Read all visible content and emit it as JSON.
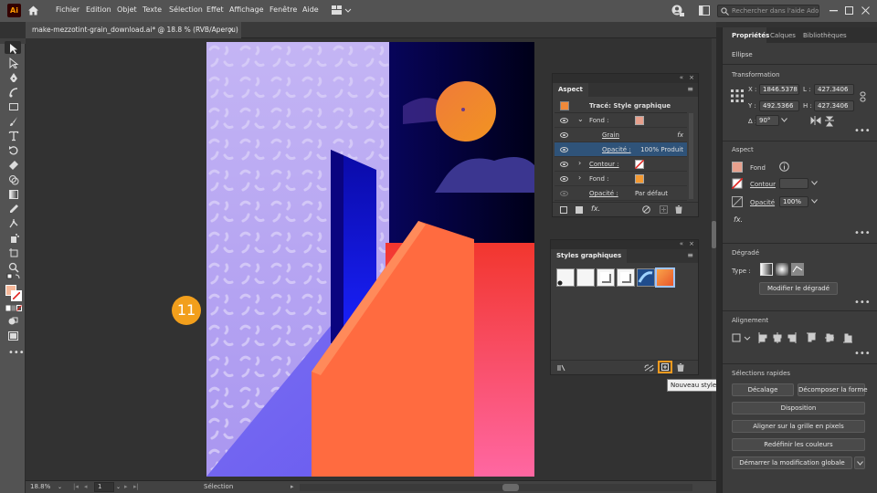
{
  "app": {
    "logo": "Ai"
  },
  "menu": [
    "Fichier",
    "Edition",
    "Objet",
    "Texte",
    "Sélection",
    "Effet",
    "Affichage",
    "Fenêtre",
    "Aide"
  ],
  "search": {
    "placeholder": "Rechercher dans l'aide Adobe"
  },
  "document": {
    "tab_title": "make-mezzotint-grain_download.ai* @ 18.8 % (RVB/Aperçu)",
    "close": "×"
  },
  "step_badge": "11",
  "aspect_panel": {
    "tab": "Aspect",
    "header": "Tracé: Style graphique",
    "rows": [
      {
        "label": "Fond :",
        "value": ""
      },
      {
        "label": "Grain",
        "value": "fx"
      },
      {
        "label": "Opacité :",
        "value": "100% Produit"
      },
      {
        "label": "Contour :",
        "value": ""
      },
      {
        "label": "Fond :",
        "value": ""
      },
      {
        "label": "Opacité :",
        "value": "Par défaut"
      }
    ],
    "footer_fx": "fx."
  },
  "styles_panel": {
    "tab": "Styles graphiques",
    "tooltip": "Nouveau style graphique"
  },
  "properties": {
    "tabs": [
      "Propriétés",
      "Calques",
      "Bibliothèques"
    ],
    "object_type": "Ellipse",
    "transformation": {
      "title": "Transformation",
      "x_label": "X :",
      "x": "1846.5378",
      "y_label": "Y :",
      "y": "492.5366 ",
      "l_label": "L :",
      "l": "427.3406 ",
      "h_label": "H :",
      "h": "427.3406 ",
      "angle_label": "∆ :",
      "angle": "90°"
    },
    "aspect": {
      "title": "Aspect",
      "fond": "Fond",
      "contour": "Contour",
      "opacite": "Opacité",
      "opacity_value": "100%",
      "fx": "fx."
    },
    "degrade": {
      "title": "Dégradé",
      "type_label": "Type :",
      "edit_button": "Modifier le dégradé"
    },
    "alignement": {
      "title": "Alignement"
    },
    "quick": {
      "title": "Sélections rapides",
      "buttons": [
        "Décalage",
        "Décomposer la forme",
        "Disposition",
        "Aligner sur la grille en pixels",
        "Redéfinir les couleurs",
        "Démarrer la modification globale"
      ]
    }
  },
  "status": {
    "zoom": "18.8%",
    "page": "1",
    "mode": "Sélection"
  }
}
